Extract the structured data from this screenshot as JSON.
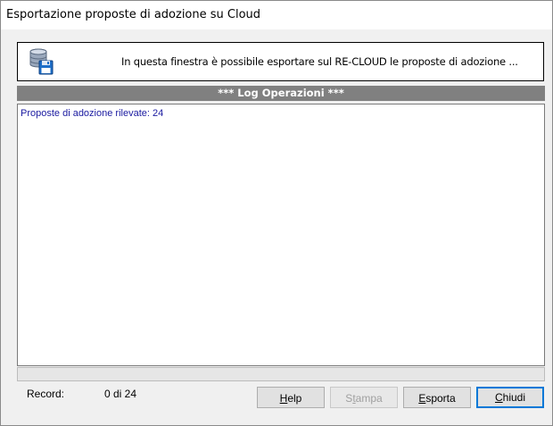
{
  "window": {
    "title": "Esportazione proposte di adozione su Cloud"
  },
  "header": {
    "icon": "database-save-icon",
    "message": "In questa finestra è possibile esportare sul RE-CLOUD le proposte di adozione ..."
  },
  "log": {
    "title": "*** Log Operazioni ***",
    "lines": [
      "Proposte di adozione rilevate: 24"
    ]
  },
  "progress": {
    "fraction": 0
  },
  "status": {
    "record_label": "Record:",
    "record_value": "0 di 24"
  },
  "buttons": {
    "help": {
      "pre": "",
      "mnemonic": "H",
      "post": "elp"
    },
    "stampa": {
      "pre": "S",
      "mnemonic": "t",
      "post": "ampa"
    },
    "esporta": {
      "pre": "",
      "mnemonic": "E",
      "post": "sporta"
    },
    "chiudi": {
      "pre": "",
      "mnemonic": "C",
      "post": "hiudi"
    }
  }
}
